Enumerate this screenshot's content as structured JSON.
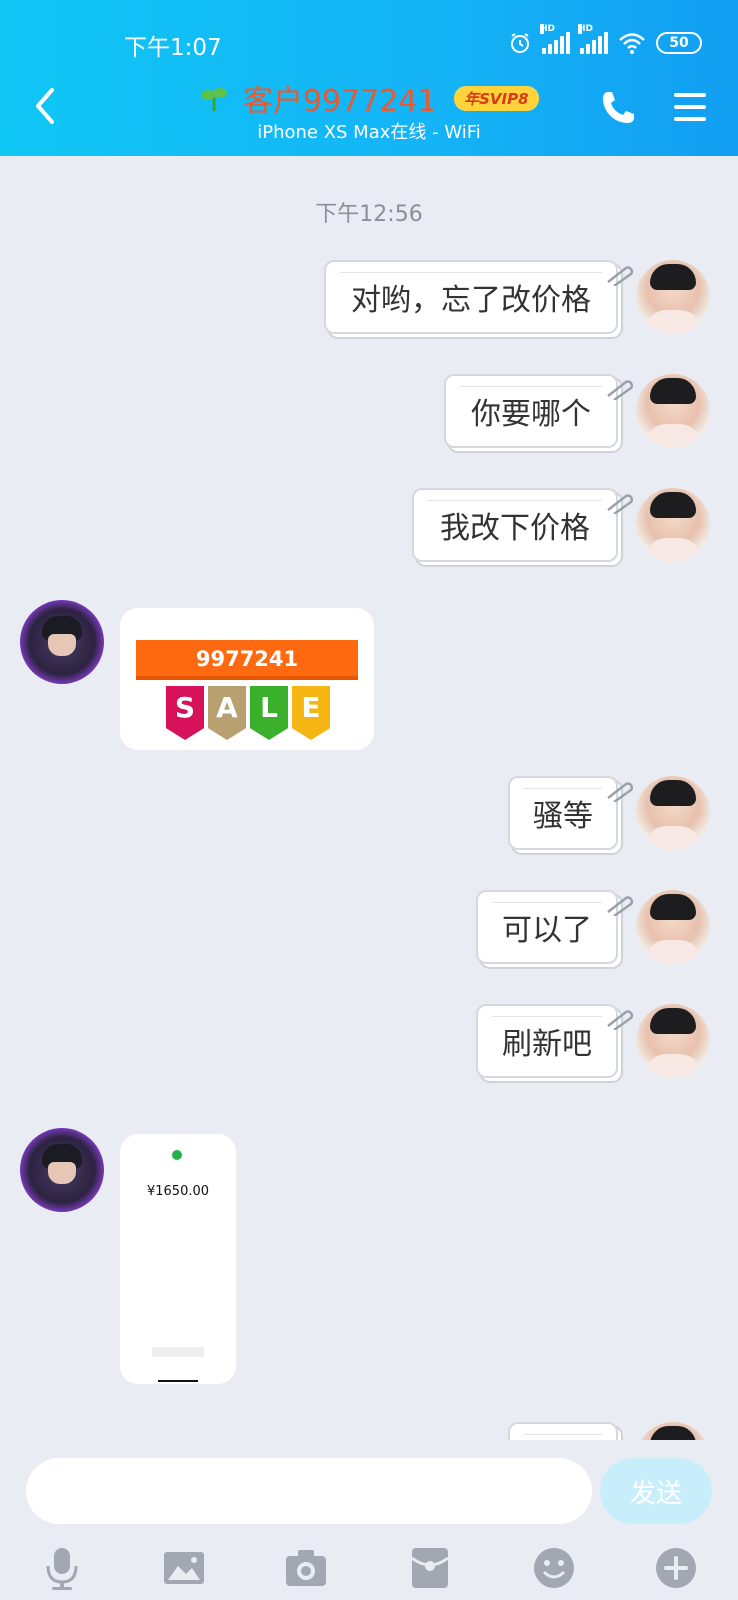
{
  "status_bar": {
    "time": "下午1:07",
    "battery": "50"
  },
  "header": {
    "title": "客户9977241",
    "badge": "年SVIP8",
    "subtitle": "iPhone XS Max在线 - WiFi"
  },
  "chat": {
    "timestamp": "下午12:56",
    "messages": [
      {
        "from": "me",
        "text": "对哟，忘了改价格"
      },
      {
        "from": "me",
        "text": "你要哪个"
      },
      {
        "from": "me",
        "text": "我改下价格"
      },
      {
        "from": "other",
        "type": "image",
        "banner_text": "9977241",
        "tag_letters": [
          "S",
          "A",
          "L",
          "E"
        ]
      },
      {
        "from": "me",
        "text": "骚等"
      },
      {
        "from": "me",
        "text": "可以了"
      },
      {
        "from": "me",
        "text": "刷新吧"
      },
      {
        "from": "other",
        "type": "image",
        "amount": "¥1650.00"
      }
    ]
  },
  "input": {
    "placeholder": "",
    "send_label": "发送"
  },
  "toolbar": {
    "icons": [
      "microphone-icon",
      "image-icon",
      "camera-icon",
      "red-packet-icon",
      "emoji-icon",
      "plus-icon"
    ]
  },
  "colors": {
    "header_gradient_start": "#10c6f5",
    "header_gradient_end": "#129ef2",
    "title": "#e85a30",
    "badge_bg": "#ffd43a",
    "chat_bg": "#e9ecf3",
    "send_button": "#c8eefb"
  }
}
